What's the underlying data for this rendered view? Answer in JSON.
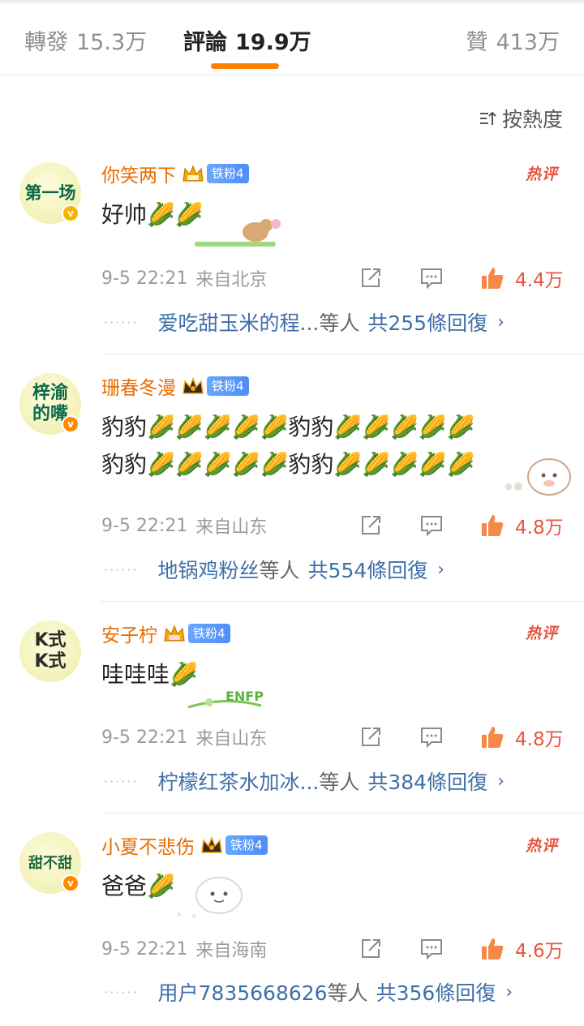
{
  "tabs": {
    "repost": {
      "label": "轉發",
      "count": "15.3万"
    },
    "comments": {
      "label": "評論",
      "count": "19.9万"
    },
    "likes": {
      "label": "贊",
      "count": "413万"
    }
  },
  "sort": {
    "label": "按熱度",
    "icon": "sort-icon"
  },
  "colors": {
    "accent": "#ff8200",
    "username": "#e86c00",
    "link": "#3f6fa8",
    "like": "#e8543f"
  },
  "comments": [
    {
      "avatar_text": "第一场",
      "username": "你笑两下",
      "fan_badge": "铁粉4",
      "hot": "热评",
      "text_lines": [
        "好帅🌽🌽"
      ],
      "time": "9-5 22:21",
      "source": "来自北京",
      "likes": "4.4万",
      "reply_user": "爱吃甜玉米的程...",
      "reply_mid": "等人",
      "reply_total": "共255條回復"
    },
    {
      "avatar_text": "梓渝的嘴",
      "username": "珊春冬漫",
      "fan_badge": "铁粉4",
      "hot": "",
      "text_lines": [
        "豹豹🌽🌽🌽🌽🌽豹豹🌽🌽🌽🌽🌽",
        "豹豹🌽🌽🌽🌽🌽豹豹🌽🌽🌽🌽🌽"
      ],
      "time": "9-5 22:21",
      "source": "来自山东",
      "likes": "4.8万",
      "reply_user": "地锅鸡粉丝",
      "reply_mid": "等人",
      "reply_total": "共554條回復"
    },
    {
      "avatar_text": "K式K式",
      "username": "安子柠",
      "fan_badge": "铁粉4",
      "hot": "热评",
      "text_lines": [
        "哇哇哇🌽"
      ],
      "time": "9-5 22:21",
      "source": "来自山东",
      "likes": "4.8万",
      "reply_user": "柠檬红茶水加冰...",
      "reply_mid": "等人",
      "reply_total": "共384條回復"
    },
    {
      "avatar_text": "甜不甜",
      "username": "小夏不悲伤",
      "fan_badge": "铁粉4",
      "hot": "热评",
      "text_lines": [
        "爸爸🌽"
      ],
      "time": "9-5 22:21",
      "source": "来自海南",
      "likes": "4.6万",
      "reply_user": "用户7835668626",
      "reply_mid": "等人",
      "reply_total": "共356條回復"
    }
  ],
  "sticker_text": "ENFP"
}
